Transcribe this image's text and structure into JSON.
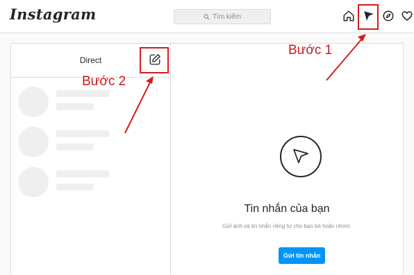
{
  "app": {
    "logo": "Instagram"
  },
  "search": {
    "placeholder": "Tìm kiếm"
  },
  "nav": {
    "icons": [
      "home-icon",
      "direct-send-icon",
      "explore-compass-icon",
      "heart-icon"
    ]
  },
  "annotations": {
    "step1": "Bước 1",
    "step2": "Bước 2",
    "highlight_color": "#d21c1c"
  },
  "direct": {
    "title": "Direct",
    "compose_icon": "new-message-icon"
  },
  "empty_state": {
    "title": "Tin nhắn của bạn",
    "subtitle": "Gửi ảnh và tin nhắn riêng tư cho bạn bè hoặc nhóm.",
    "button_label": "Gửi tin nhắn",
    "button_color": "#0095f6"
  }
}
